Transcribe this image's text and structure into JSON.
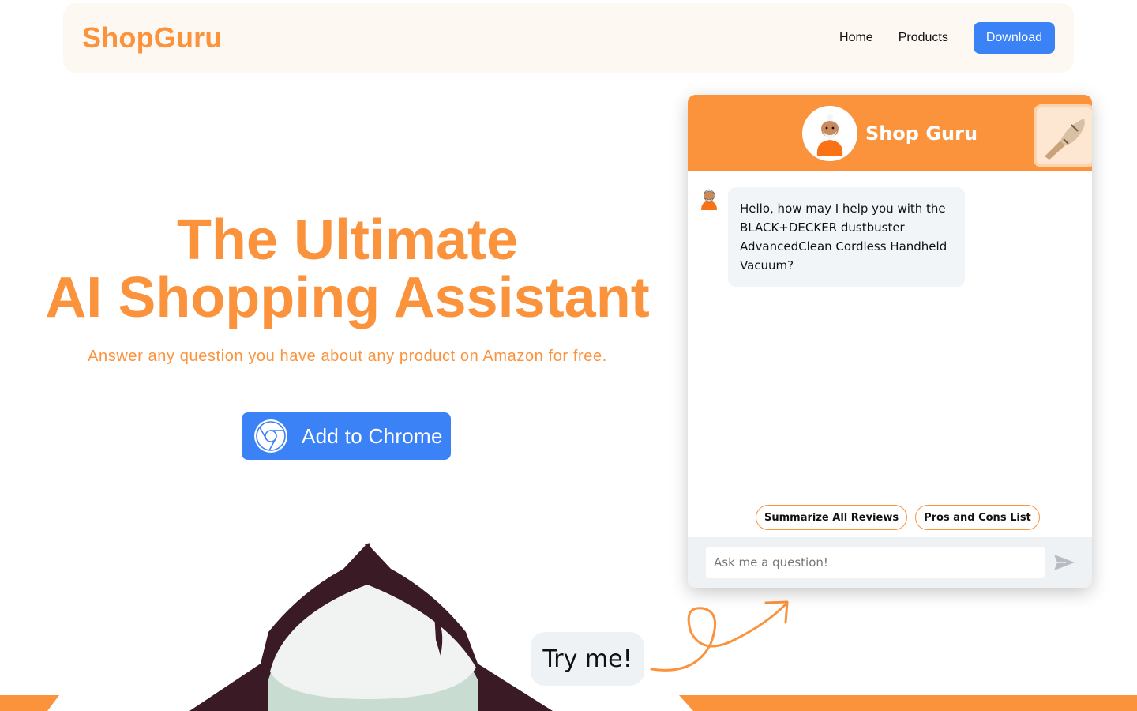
{
  "header": {
    "brand": "ShopGuru",
    "nav": {
      "home": "Home",
      "products": "Products"
    },
    "download_label": "Download"
  },
  "hero": {
    "title_line1": "The Ultimate",
    "title_line2": "AI Shopping Assistant",
    "subtitle": "Answer any question you have about any product on Amazon for free.",
    "cta_label": "Add to Chrome"
  },
  "try_me": "Try me!",
  "chat": {
    "title": "Shop Guru",
    "message": "Hello, how may I help you with the BLACK+DECKER dustbuster AdvancedClean Cordless Handheld Vacuum?",
    "suggestions": [
      "Summarize All Reviews",
      "Pros and Cons List"
    ],
    "input_placeholder": "Ask me a question!"
  },
  "icons": {
    "chrome": "chrome-icon",
    "avatar": "guru-avatar-icon",
    "send": "send-icon",
    "product": "vacuum-product-icon"
  },
  "colors": {
    "accent": "#fb923c",
    "primary": "#3b82f6",
    "nav_bg": "#fef8f3",
    "bubble_bg": "#f1f5f8"
  }
}
